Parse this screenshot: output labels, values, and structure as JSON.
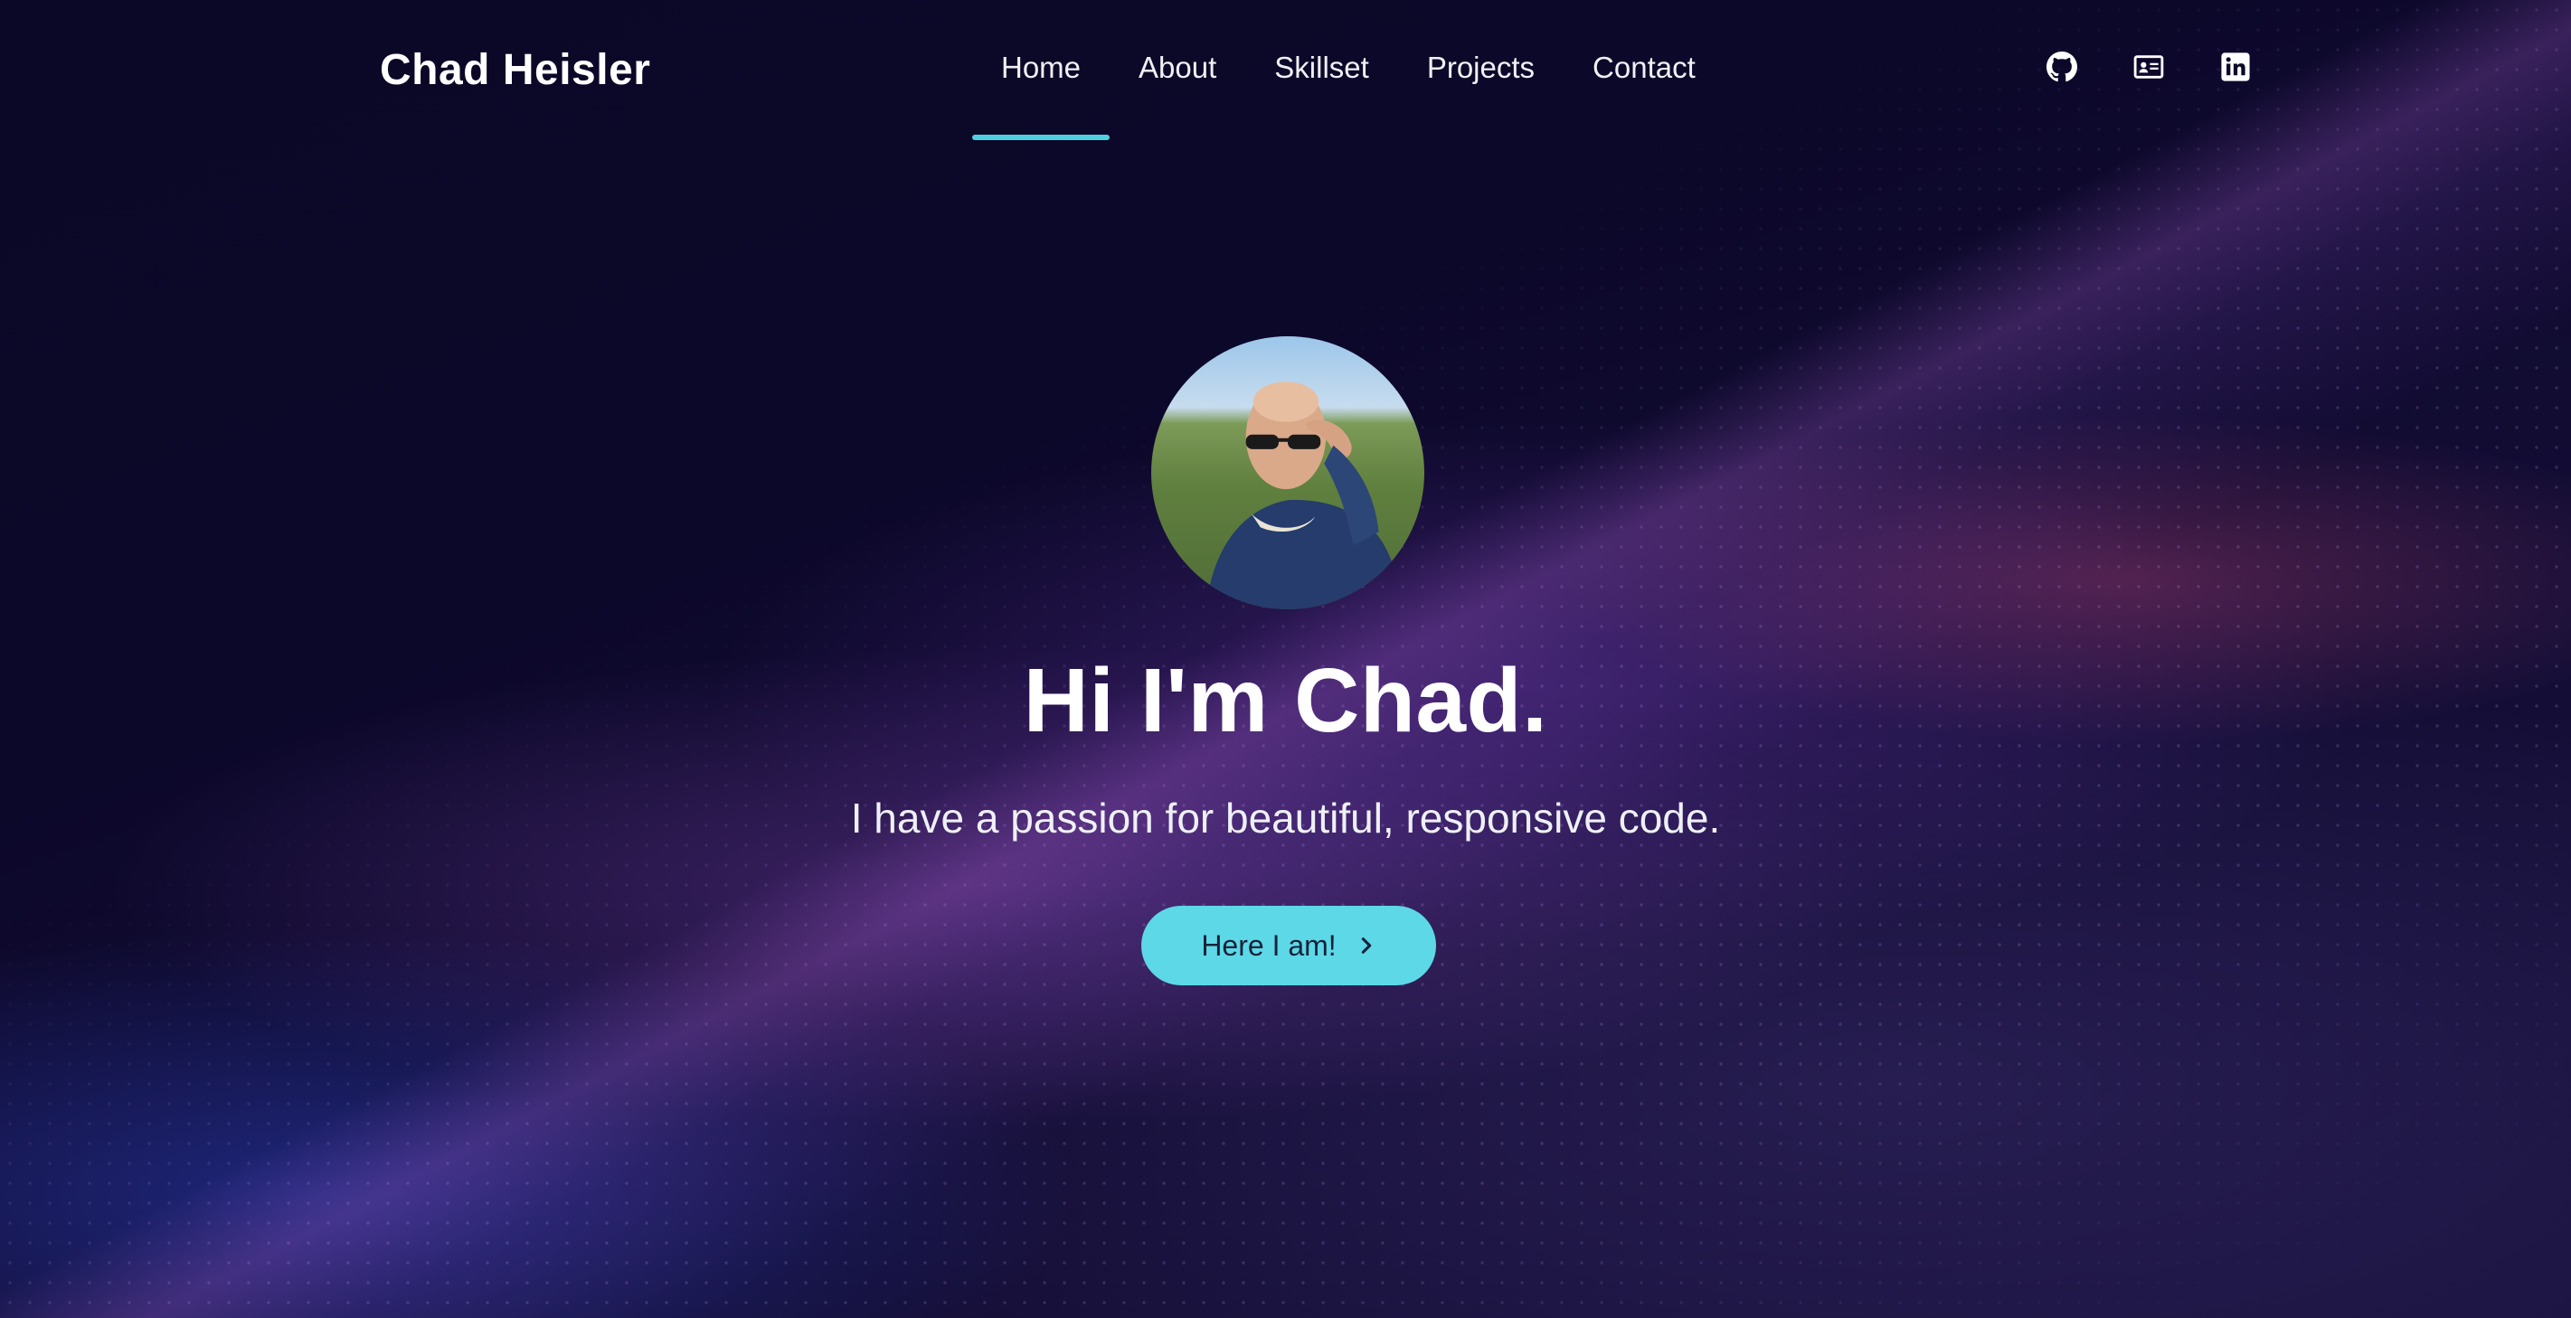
{
  "header": {
    "brand": "Chad Heisler",
    "nav": [
      {
        "label": "Home",
        "active": true
      },
      {
        "label": "About",
        "active": false
      },
      {
        "label": "Skillset",
        "active": false
      },
      {
        "label": "Projects",
        "active": false
      },
      {
        "label": "Contact",
        "active": false
      }
    ],
    "socials": [
      "github-icon",
      "contact-card-icon",
      "linkedin-icon"
    ],
    "accent": "#4fd0e0"
  },
  "hero": {
    "headline": "Hi I'm Chad.",
    "tagline": "I have a passion for beautiful, responsive code.",
    "cta_label": "Here I am!",
    "cta_color": "#5dd8e6"
  }
}
